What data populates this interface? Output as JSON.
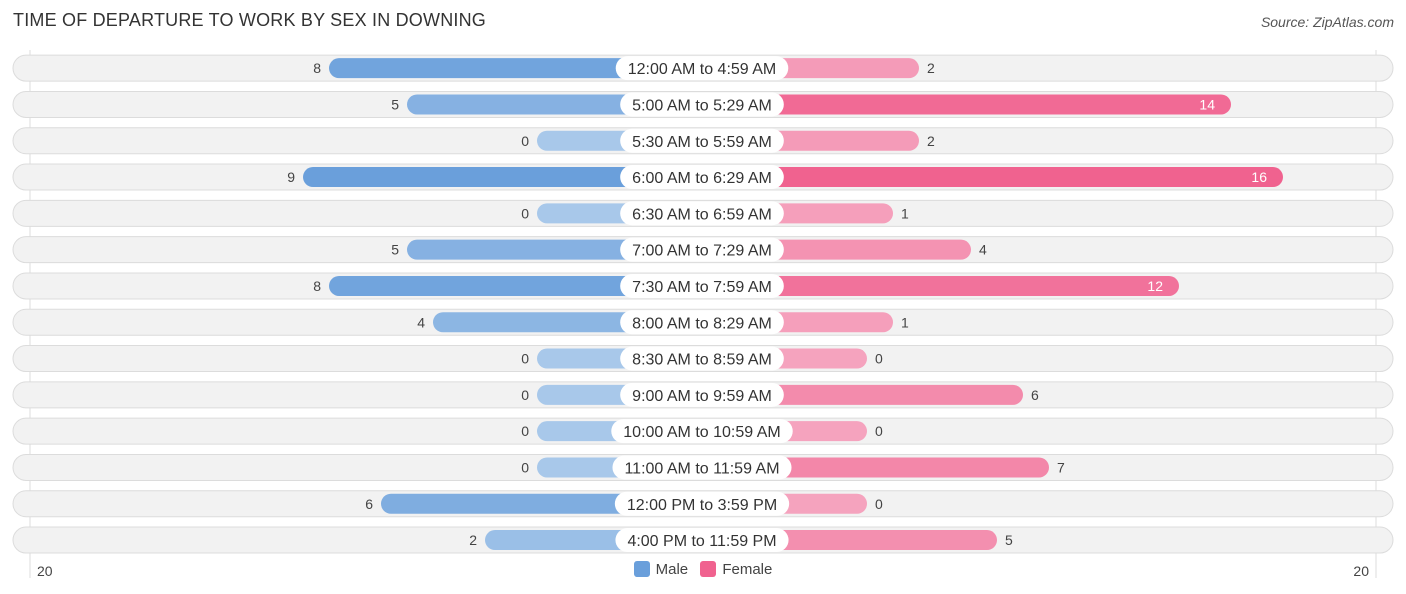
{
  "title": "TIME OF DEPARTURE TO WORK BY SEX IN DOWNING",
  "source": "Source: ZipAtlas.com",
  "colors": {
    "male": "#6a9fdb",
    "male_light": "#a8c8ea",
    "female": "#f0628f",
    "female_light": "#f5a3be",
    "track": "#f2f2f2"
  },
  "chart_data": {
    "type": "bar",
    "orientation": "horizontal-diverging",
    "title": "TIME OF DEPARTURE TO WORK BY SEX IN DOWNING",
    "categories": [
      "12:00 AM to 4:59 AM",
      "5:00 AM to 5:29 AM",
      "5:30 AM to 5:59 AM",
      "6:00 AM to 6:29 AM",
      "6:30 AM to 6:59 AM",
      "7:00 AM to 7:29 AM",
      "7:30 AM to 7:59 AM",
      "8:00 AM to 8:29 AM",
      "8:30 AM to 8:59 AM",
      "9:00 AM to 9:59 AM",
      "10:00 AM to 10:59 AM",
      "11:00 AM to 11:59 AM",
      "12:00 PM to 3:59 PM",
      "4:00 PM to 11:59 PM"
    ],
    "series": [
      {
        "name": "Male",
        "values": [
          8,
          5,
          0,
          9,
          0,
          5,
          8,
          4,
          0,
          0,
          0,
          0,
          6,
          2
        ]
      },
      {
        "name": "Female",
        "values": [
          2,
          14,
          2,
          16,
          1,
          4,
          12,
          1,
          0,
          6,
          0,
          7,
          0,
          5
        ]
      }
    ],
    "axis_min_label": "20",
    "axis_max_label": "20",
    "xlim": [
      -20,
      20
    ],
    "legend": {
      "position": "bottom-center",
      "entries": [
        "Male",
        "Female"
      ]
    }
  }
}
